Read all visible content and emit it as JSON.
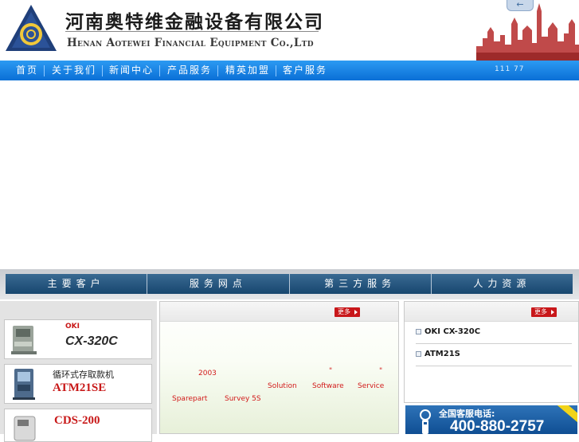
{
  "header": {
    "company_cn": "河南奥特维金融设备有限公司",
    "company_en": "Henan Aotewei Financial Equipment Co.,Ltd",
    "back_icon": "back-arrow-icon"
  },
  "nav": {
    "items": [
      "首页",
      "关于我们",
      "新闻中心",
      "产品服务",
      "精英加盟",
      "客户服务"
    ],
    "code": "111 77"
  },
  "sections": {
    "tabs": [
      "主要客户",
      "服务网点",
      "第三方服务",
      "人力资源"
    ]
  },
  "products": [
    {
      "brand": "OKI",
      "name": "CX-320C"
    },
    {
      "brand": "",
      "name_cn": "循环式存取款机",
      "name": "ATM21SE"
    },
    {
      "brand": "",
      "name": "CDS-200"
    }
  ],
  "middle": {
    "more_label": "更多",
    "lines": [
      {
        "text": "2003"
      },
      {
        "text": "\""
      },
      {
        "text": "\""
      },
      {
        "text": "Solution"
      },
      {
        "text": "Software"
      },
      {
        "text": "Service"
      },
      {
        "text": "Sparepart"
      },
      {
        "text": "Survey 5S"
      }
    ]
  },
  "right": {
    "more_label": "更多",
    "news": [
      "OKI CX-320C",
      "ATM21S"
    ]
  },
  "hotline": {
    "label": "全国客服电话:",
    "number": "400-880-2757"
  },
  "colors": {
    "nav_blue": "#0a6fd6",
    "section_blue": "#17466f",
    "more_red": "#c8171a",
    "logo_navy": "#1f3f7a"
  }
}
